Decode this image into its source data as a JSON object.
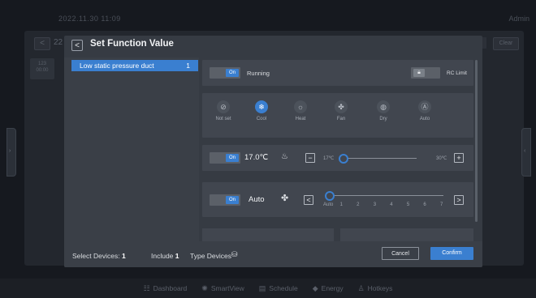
{
  "background": {
    "datetime": "2022.11.30   11:09",
    "user": "Admin",
    "row_number": "22",
    "clear_label": "Clear",
    "tile": {
      "line1": "123",
      "line2": "00:00"
    }
  },
  "bottom_nav": [
    {
      "icon": "dashboard-icon",
      "glyph": "☷",
      "label": "Dashboard"
    },
    {
      "icon": "smartview-icon",
      "glyph": "✺",
      "label": "SmartView"
    },
    {
      "icon": "schedule-icon",
      "glyph": "▤",
      "label": "Schedule"
    },
    {
      "icon": "energy-icon",
      "glyph": "◆",
      "label": "Energy"
    },
    {
      "icon": "hotkeys-icon",
      "glyph": "♙",
      "label": "Hotkeys"
    }
  ],
  "modal": {
    "title": "Set Function Value",
    "device_types": [
      {
        "name": "Low static pressure duct",
        "count": "1"
      }
    ],
    "power": {
      "toggle": "On",
      "status": "Running",
      "rc_limit": "RC Limit"
    },
    "modes": [
      {
        "label": "Not set",
        "icon": "not-set-icon",
        "glyph": "⊘",
        "selected": false
      },
      {
        "label": "Cool",
        "icon": "cool-icon",
        "glyph": "❄",
        "selected": true
      },
      {
        "label": "Heat",
        "icon": "heat-icon",
        "glyph": "☼",
        "selected": false
      },
      {
        "label": "Fan",
        "icon": "fan-icon",
        "glyph": "✤",
        "selected": false
      },
      {
        "label": "Dry",
        "icon": "dry-icon",
        "glyph": "◍",
        "selected": false
      },
      {
        "label": "Auto",
        "icon": "auto-icon",
        "glyph": "Ⓐ",
        "selected": false
      }
    ],
    "temperature": {
      "toggle": "On",
      "value": "17.0℃",
      "min_label": "17℃",
      "max_label": "30℃",
      "level": 0
    },
    "fan_speed": {
      "toggle": "On",
      "value": "Auto",
      "ticks": [
        "Auto",
        "1",
        "2",
        "3",
        "4",
        "5",
        "6",
        "7"
      ],
      "level": 0
    },
    "footer": {
      "select_devices_label": "Select Devices:",
      "select_devices_count": "1",
      "include_label": "Include",
      "include_count": "1",
      "type_devices_label": "Type Devices",
      "cancel": "Cancel",
      "confirm": "Confirm"
    }
  },
  "colors": {
    "accent": "#3a7fd0",
    "modal_bg": "#363b43",
    "card_bg": "#41464f"
  }
}
